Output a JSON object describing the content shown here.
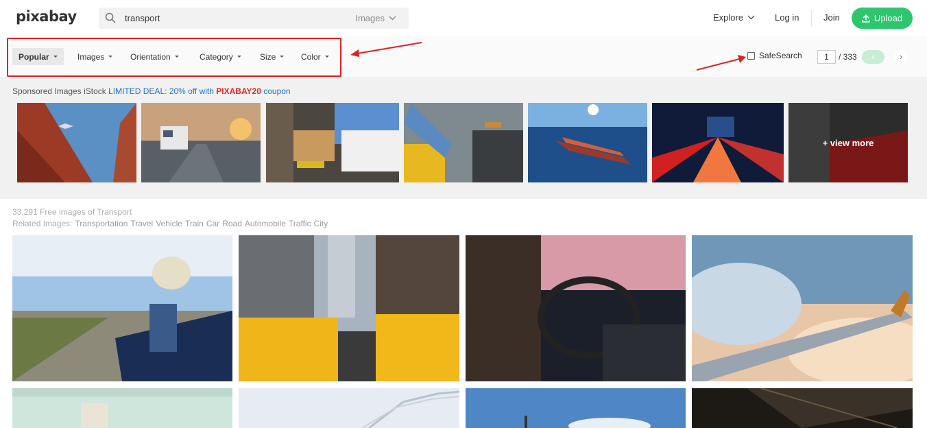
{
  "header": {
    "logo": "pixabay",
    "search_query": "transport",
    "search_type": "Images",
    "nav_explore": "Explore",
    "nav_login": "Log in",
    "nav_join": "Join",
    "upload": "Upload"
  },
  "filters": [
    {
      "label": "Popular",
      "active": true
    },
    {
      "label": "Images",
      "active": false
    },
    {
      "label": "Orientation",
      "active": false
    },
    {
      "label": "Category",
      "active": false
    },
    {
      "label": "Size",
      "active": false
    },
    {
      "label": "Color",
      "active": false
    }
  ],
  "safesearch": {
    "label": "SafeSearch",
    "checked": false
  },
  "pager": {
    "current": "1",
    "total": "/ 333",
    "prev": "‹",
    "next": "›"
  },
  "sponsored": {
    "prefix": "Sponsored Images iStock",
    "deal": "LIMITED DEAL: 20% off with",
    "code": "PIXABAY20",
    "suffix": "coupon",
    "view_more": "+ view more"
  },
  "results": {
    "count": "33,291 Free images of Transport",
    "related_label": "Related Images:",
    "related": [
      "Transportation",
      "Travel",
      "Vehicle",
      "Train",
      "Car",
      "Road",
      "Automobile",
      "Traffic",
      "City"
    ]
  },
  "colors": {
    "brand_green": "#2ec66d",
    "annotation_red": "#e02020",
    "deal_blue": "#1b73d2"
  }
}
